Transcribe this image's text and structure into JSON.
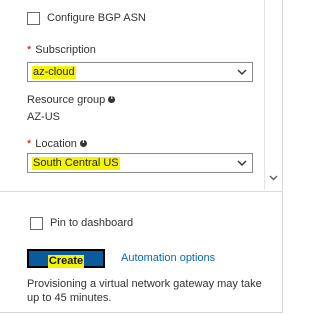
{
  "form": {
    "configure_bgp_asn": {
      "label": "Configure BGP ASN",
      "checked": false
    },
    "subscription": {
      "required_marker": "*",
      "label": "Subscription",
      "value": "az-cloud"
    },
    "resource_group": {
      "label": "Resource group",
      "value": "AZ-US",
      "info_icon": "info-icon"
    },
    "location": {
      "required_marker": "*",
      "label": "Location",
      "value": "South Central US",
      "info_icon": "info-icon"
    }
  },
  "footer": {
    "pin_to_dashboard": {
      "label": "Pin to dashboard",
      "checked": false
    },
    "create_label": "Create",
    "automation_label": "Automation options",
    "note": "Provisioning a virtual network gateway may take up to 45 minutes."
  },
  "colors": {
    "highlight": "#f6f500",
    "button": "#0a5a9e",
    "link": "#0a66b8",
    "required": "#c00000"
  }
}
